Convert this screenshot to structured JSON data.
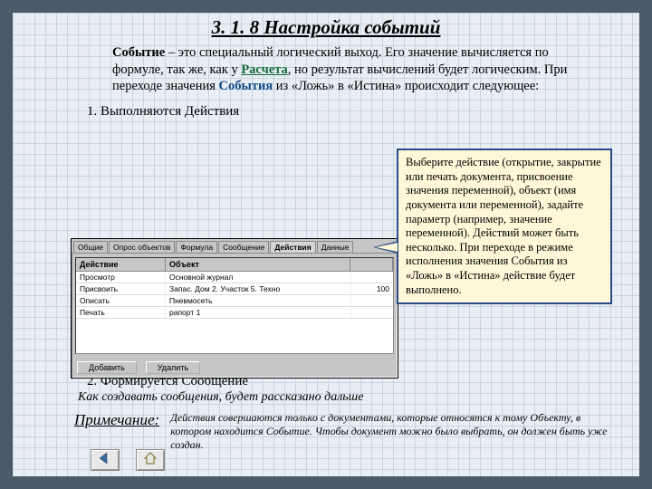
{
  "title": "3. 1. 8 Настройка событий",
  "intro": {
    "t1a": "Событие",
    "t1b": " – это специальный логический выход. Его значение вычисляется по формуле, так же, как у ",
    "t1c": "Расчета",
    "t1d": ", но результат вычислений будет логическим.  При переходе значения ",
    "t1e": "События",
    "t1f": " из «Ложь» в «Истина» происходит следующее:"
  },
  "step1": "1. Выполняются Действия",
  "callout": "Выберите действие  (открытие, закрытие или печать документа, присвоение значения переменной), объект (имя документа или переменной), задайте параметр (например, значение переменной). Действий может быть несколько. При переходе в режиме исполнения значения События из «Ложь» в «Истина» действие будет выполнено.",
  "dialog": {
    "tabs": [
      "Общие",
      "Опрос объектов",
      "Формула",
      "Сообщение",
      "Действия",
      "Данные"
    ],
    "active_tab": 4,
    "columns": {
      "c1": "Действие",
      "c2": "Объект",
      "c3": ""
    },
    "rows": [
      {
        "c1": "Просмотр",
        "c2": "Основной журнал",
        "c3": ""
      },
      {
        "c1": "Присвоить",
        "c2": "Запас. Дом 2. Участок 5. Техно",
        "c3": "100"
      },
      {
        "c1": "Описать",
        "c2": "Пневмосеть",
        "c3": ""
      },
      {
        "c1": "Печать",
        "c2": "рапорт 1",
        "c3": ""
      }
    ],
    "buttons": {
      "add": "Добавить",
      "del": "Удалить"
    }
  },
  "step2": "2. Формируется Сообщение",
  "step2note": "Как создавать сообщения, будет рассказано дальше",
  "note": {
    "label": "Примечание:",
    "text": "Действия совершаются только с документами, которые относятся к тому Объекту, в котором находится Событие. Чтобы документ можно было выбрать, он должен быть уже создан."
  }
}
